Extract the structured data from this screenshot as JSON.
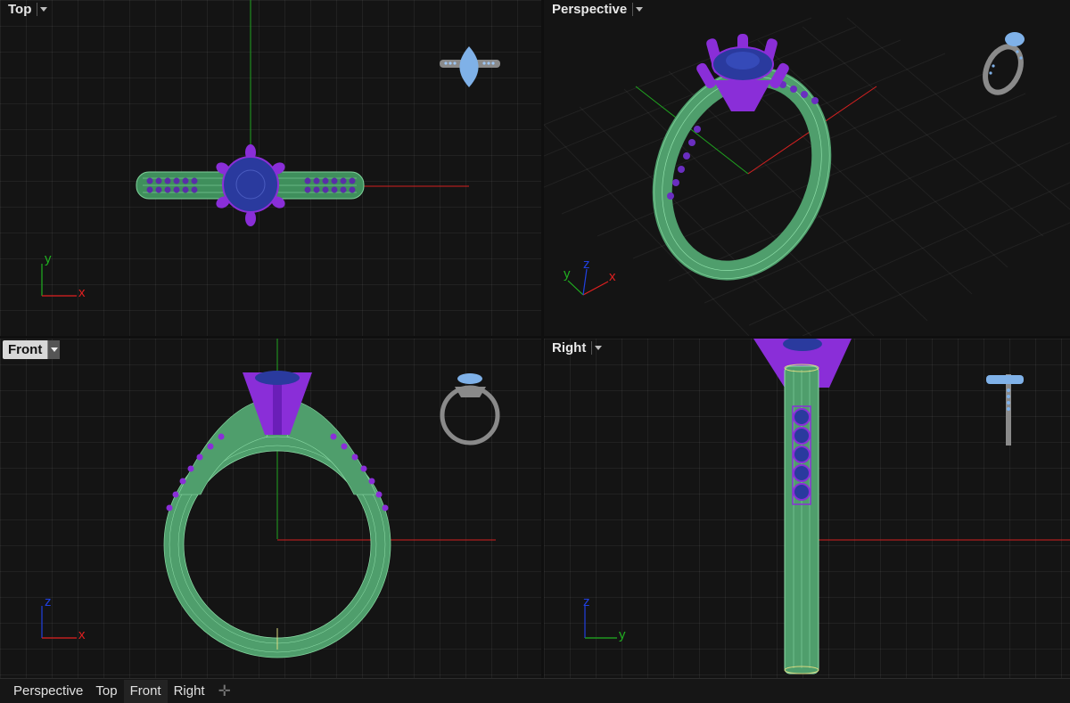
{
  "viewports": {
    "top": {
      "title": "Top"
    },
    "perspective": {
      "title": "Perspective"
    },
    "front": {
      "title": "Front"
    },
    "right": {
      "title": "Right"
    }
  },
  "axes": {
    "x_label": "x",
    "y_label": "y",
    "z_label": "z",
    "x_color": "#e02020",
    "y_color": "#20b020",
    "z_color": "#2040e0"
  },
  "colors": {
    "band": "#4f9e6c",
    "prong": "#8a2ed8",
    "gem": "#2b3e9c",
    "gem_preview": "#7fb1e8",
    "metal_preview": "#8a8a8a",
    "viewport_bg": "#141414"
  },
  "tabs": [
    {
      "label": "Perspective",
      "active": false
    },
    {
      "label": "Top",
      "active": false
    },
    {
      "label": "Front",
      "active": true
    },
    {
      "label": "Right",
      "active": false
    }
  ],
  "tab_add_icon": "plus-icon"
}
